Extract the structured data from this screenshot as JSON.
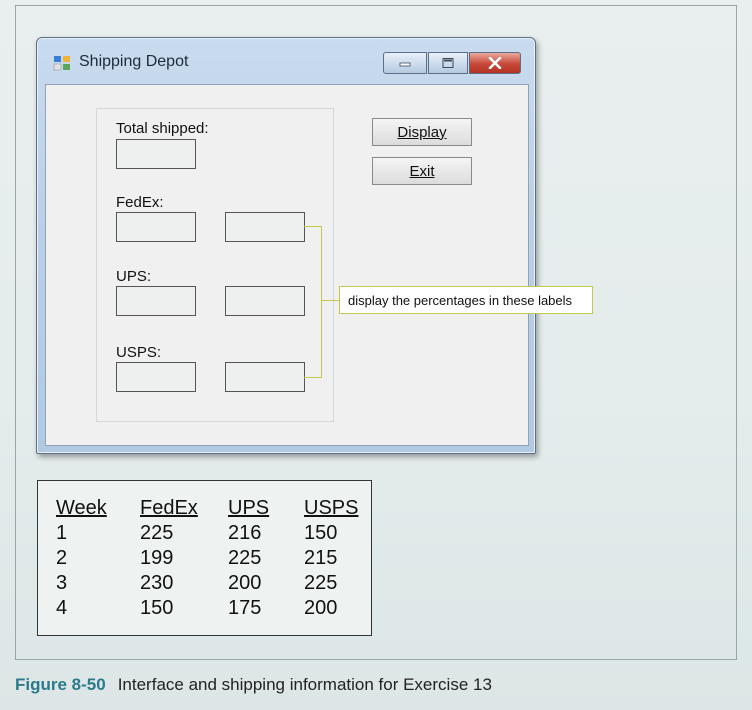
{
  "window": {
    "title": "Shipping Depot",
    "icon": "windows-form-icon",
    "controls": [
      "minimize-icon",
      "maximize-icon",
      "close-icon"
    ]
  },
  "form": {
    "total_label": "Total shipped:",
    "fedex_label": "FedEx:",
    "ups_label": "UPS:",
    "usps_label": "USPS:",
    "display_button": "Display",
    "exit_button": "Exit"
  },
  "callout": {
    "text": "display the percentages in these labels",
    "color": "#c6c84a"
  },
  "table": {
    "headers": [
      "Week",
      "FedEx",
      "UPS",
      "USPS"
    ],
    "rows": [
      [
        "1",
        "225",
        "216",
        "150"
      ],
      [
        "2",
        "199",
        "225",
        "215"
      ],
      [
        "3",
        "230",
        "200",
        "225"
      ],
      [
        "4",
        "150",
        "175",
        "200"
      ]
    ]
  },
  "caption": {
    "label": "Figure 8-50",
    "text": "Interface and shipping information for Exercise 13",
    "label_color": "#2b7a8c"
  }
}
